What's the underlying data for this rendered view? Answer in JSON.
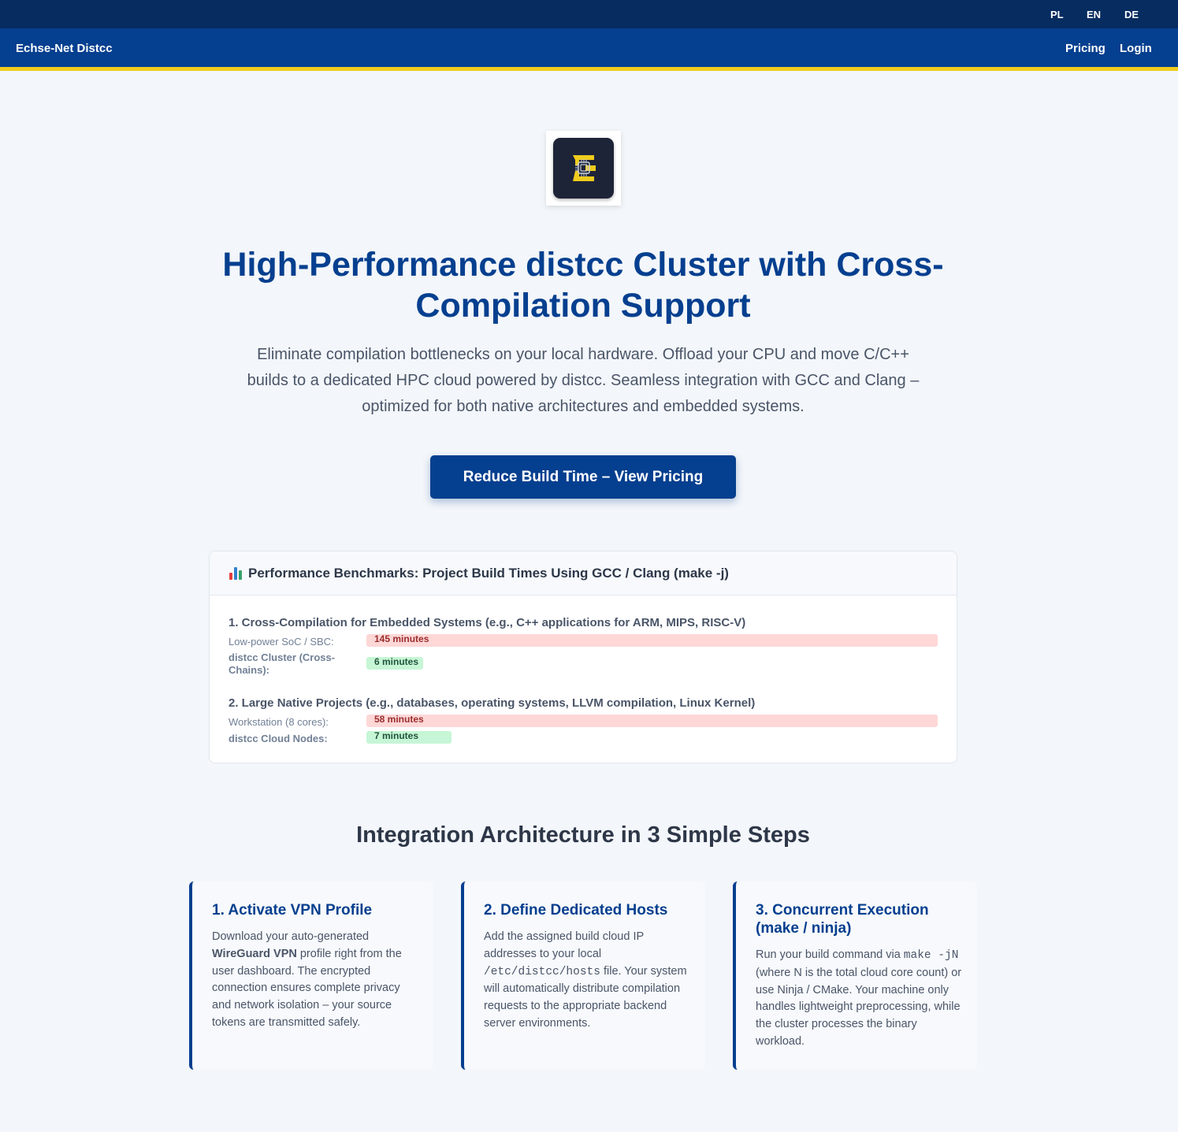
{
  "languages": [
    "PL",
    "EN",
    "DE"
  ],
  "nav": {
    "brand": "Echse-Net Distcc",
    "links": [
      "Pricing",
      "Login"
    ]
  },
  "logo": {
    "icon": "chip-e-logo",
    "bg_color": "#1e2438",
    "accent_color": "#f0cc1d"
  },
  "hero": {
    "title": "High-Performance distcc Cluster with Cross-Compilation Support",
    "subtitle": "Eliminate compilation bottlenecks on your local hardware. Offload your CPU and move C/C++ builds to a dedicated HPC cloud powered by distcc. Seamless integration with GCC and Clang – optimized for both native architectures and embedded systems.",
    "cta": "Reduce Build Time – View Pricing"
  },
  "benchmarks": {
    "icon": "bar-chart-icon",
    "title": "Performance Benchmarks: Project Build Times Using GCC / Clang (make -j)",
    "groups": [
      {
        "title": "1. Cross-Compilation for Embedded Systems (e.g., C++ applications for ARM, MIPS, RISC-V)",
        "rows": [
          {
            "label": "Low-power SoC / SBC:",
            "value_text": "145 minutes",
            "minutes": 145,
            "fill": 1.0
          },
          {
            "label": "distcc Cluster (Cross-Chains):",
            "value_text": "6 minutes",
            "minutes": 6,
            "fill": 0.1
          }
        ]
      },
      {
        "title": "2. Large Native Projects (e.g., databases, operating systems, LLVM compilation, Linux Kernel)",
        "rows": [
          {
            "label": "Workstation (8 cores):",
            "value_text": "58 minutes",
            "minutes": 58,
            "fill": 1.0
          },
          {
            "label": "distcc Cloud Nodes:",
            "value_text": "7 minutes",
            "minutes": 7,
            "fill": 0.15
          }
        ]
      }
    ]
  },
  "steps": {
    "title": "Integration Architecture in 3 Simple Steps",
    "cards": [
      {
        "title": "1. Activate VPN Profile",
        "text_before": "Download your auto-generated ",
        "strong": "WireGuard VPN",
        "text_after": " profile right from the user dashboard. The encrypted connection ensures complete privacy and network isolation – your source tokens are transmitted safely."
      },
      {
        "title": "2. Define Dedicated Hosts",
        "text_before": "Add the assigned build cloud IP addresses to your local ",
        "code": "/etc/distcc/hosts",
        "text_after": " file. Your system will automatically distribute compilation requests to the appropriate backend server environments."
      },
      {
        "title": "3. Concurrent Execution (make / ninja)",
        "text_before": "Run your build command via ",
        "code": "make -jN",
        "text_after": " (where N is the total cloud core count) or use Ninja / CMake. Your machine only handles lightweight preprocessing, while the cluster processes the binary workload."
      }
    ]
  },
  "colors": {
    "topbar": "#062c60",
    "navbar": "#053f8f",
    "accent_stripe": "#f0cc1d",
    "primary": "#053f8f",
    "slow_bar": "#fed7d7",
    "fast_bar": "#c6f6d5"
  }
}
